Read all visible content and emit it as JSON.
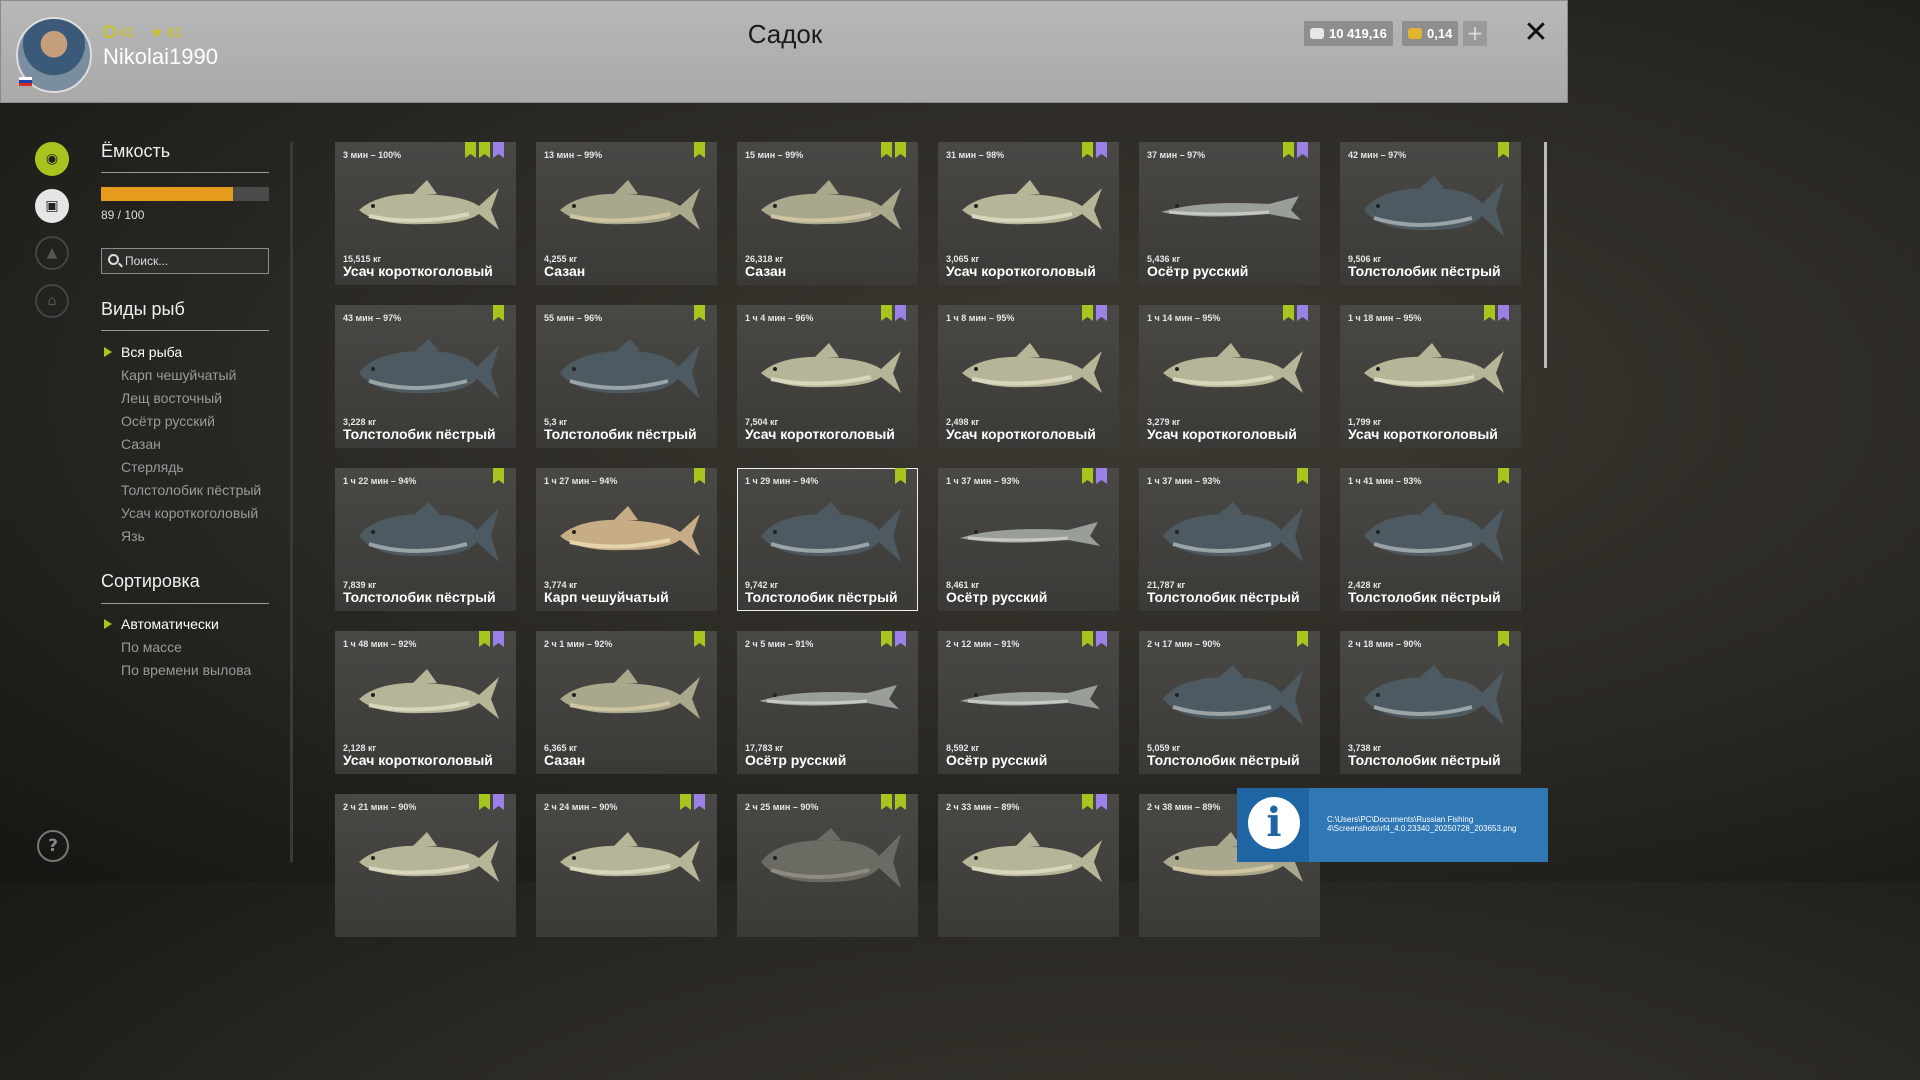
{
  "header": {
    "title": "Садок",
    "level": "41",
    "rank": "81",
    "username": "Nikolai1990",
    "silver": "10 419,16",
    "gold": "0,14",
    "plus_label": "+",
    "close_label": "✕"
  },
  "capacity": {
    "title": "Ёмкость",
    "text": "89 / 100",
    "filled": 89,
    "max": 100,
    "color": "#e79b1c"
  },
  "search": {
    "placeholder": "Поиск..."
  },
  "species": {
    "title": "Виды рыб",
    "items": [
      "Вся рыба",
      "Карп чешуйчатый",
      "Лещ восточный",
      "Осётр русский",
      "Сазан",
      "Стерлядь",
      "Толстолобик пёстрый",
      "Усач короткоголовый",
      "Язь"
    ],
    "selected": 0
  },
  "sort": {
    "title": "Сортировка",
    "items": [
      "Автоматически",
      "По массе",
      "По времени вылова"
    ],
    "selected": 0
  },
  "help_label": "?",
  "cards": [
    {
      "time": "3 мин – 100%",
      "mass": "15,515 кг",
      "name": "Усач короткоголовый",
      "badges": [
        "green",
        "yellow",
        "purple"
      ],
      "fish": "barbel"
    },
    {
      "time": "13 мин – 99%",
      "mass": "4,255 кг",
      "name": "Сазан",
      "badges": [
        "green"
      ],
      "fish": "carp"
    },
    {
      "time": "15 мин – 99%",
      "mass": "26,318 кг",
      "name": "Сазан",
      "badges": [
        "green",
        "yellow"
      ],
      "fish": "carp"
    },
    {
      "time": "31 мин – 98%",
      "mass": "3,065 кг",
      "name": "Усач короткоголовый",
      "badges": [
        "green",
        "purple"
      ],
      "fish": "barbel"
    },
    {
      "time": "37 мин – 97%",
      "mass": "5,436 кг",
      "name": "Осётр русский",
      "badges": [
        "green",
        "purple"
      ],
      "fish": "sturgeon"
    },
    {
      "time": "42 мин – 97%",
      "mass": "9,506 кг",
      "name": "Толстолобик пёстрый",
      "badges": [
        "green"
      ],
      "fish": "bighead"
    },
    {
      "time": "43 мин – 97%",
      "mass": "3,228 кг",
      "name": "Толстолобик пёстрый",
      "badges": [
        "green"
      ],
      "fish": "bighead"
    },
    {
      "time": "55 мин – 96%",
      "mass": "5,3 кг",
      "name": "Толстолобик пёстрый",
      "badges": [
        "green"
      ],
      "fish": "bighead"
    },
    {
      "time": "1 ч 4 мин – 96%",
      "mass": "7,504 кг",
      "name": "Усач короткоголовый",
      "badges": [
        "green",
        "purple"
      ],
      "fish": "barbel"
    },
    {
      "time": "1 ч 8 мин – 95%",
      "mass": "2,498 кг",
      "name": "Усач короткоголовый",
      "badges": [
        "green",
        "purple"
      ],
      "fish": "barbel"
    },
    {
      "time": "1 ч 14 мин – 95%",
      "mass": "3,279 кг",
      "name": "Усач короткоголовый",
      "badges": [
        "green",
        "purple"
      ],
      "fish": "barbel"
    },
    {
      "time": "1 ч 18 мин – 95%",
      "mass": "1,799 кг",
      "name": "Усач короткоголовый",
      "badges": [
        "green",
        "purple"
      ],
      "fish": "barbel"
    },
    {
      "time": "1 ч 22 мин – 94%",
      "mass": "7,839 кг",
      "name": "Толстолобик пёстрый",
      "badges": [
        "green"
      ],
      "fish": "bighead"
    },
    {
      "time": "1 ч 27 мин – 94%",
      "mass": "3,774 кг",
      "name": "Карп чешуйчатый",
      "badges": [
        "green"
      ],
      "fish": "goldcarp"
    },
    {
      "time": "1 ч 29 мин – 94%",
      "mass": "9,742 кг",
      "name": "Толстолобик пёстрый",
      "badges": [
        "green"
      ],
      "fish": "bighead",
      "selected": true
    },
    {
      "time": "1 ч 37 мин – 93%",
      "mass": "8,461 кг",
      "name": "Осётр русский",
      "badges": [
        "green",
        "purple"
      ],
      "fish": "sturgeon"
    },
    {
      "time": "1 ч 37 мин – 93%",
      "mass": "21,787 кг",
      "name": "Толстолобик пёстрый",
      "badges": [
        "green"
      ],
      "fish": "bighead"
    },
    {
      "time": "1 ч 41 мин – 93%",
      "mass": "2,428 кг",
      "name": "Толстолобик пёстрый",
      "badges": [
        "green"
      ],
      "fish": "bighead"
    },
    {
      "time": "1 ч 48 мин – 92%",
      "mass": "2,128 кг",
      "name": "Усач короткоголовый",
      "badges": [
        "green",
        "purple"
      ],
      "fish": "barbel"
    },
    {
      "time": "2 ч 1 мин – 92%",
      "mass": "6,365 кг",
      "name": "Сазан",
      "badges": [
        "green"
      ],
      "fish": "carp"
    },
    {
      "time": "2 ч 5 мин – 91%",
      "mass": "17,783 кг",
      "name": "Осётр русский",
      "badges": [
        "green",
        "purple"
      ],
      "fish": "sturgeon"
    },
    {
      "time": "2 ч 12 мин – 91%",
      "mass": "8,592 кг",
      "name": "Осётр русский",
      "badges": [
        "green",
        "purple"
      ],
      "fish": "sturgeon"
    },
    {
      "time": "2 ч 17 мин – 90%",
      "mass": "5,059 кг",
      "name": "Толстолобик пёстрый",
      "badges": [
        "green"
      ],
      "fish": "bighead"
    },
    {
      "time": "2 ч 18 мин – 90%",
      "mass": "3,738 кг",
      "name": "Толстолобик пёстрый",
      "badges": [
        "green"
      ],
      "fish": "bighead"
    },
    {
      "time": "2 ч 21 мин – 90%",
      "mass": "",
      "name": "",
      "badges": [
        "green",
        "purple"
      ],
      "fish": "barbel"
    },
    {
      "time": "2 ч 24 мин – 90%",
      "mass": "",
      "name": "",
      "badges": [
        "green",
        "purple"
      ],
      "fish": "barbel"
    },
    {
      "time": "2 ч 25 мин – 90%",
      "mass": "",
      "name": "",
      "badges": [
        "green",
        "yellow"
      ],
      "fish": "bream"
    },
    {
      "time": "2 ч 33 мин – 89%",
      "mass": "",
      "name": "",
      "badges": [
        "green",
        "purple"
      ],
      "fish": "barbel"
    },
    {
      "time": "2 ч 38 мин – 89%",
      "mass": "",
      "name": "",
      "badges": [
        "green"
      ],
      "fish": "carp"
    }
  ],
  "notification": {
    "path": "C:\\Users\\PC\\Documents\\Russian Fishing 4\\Screenshots\\rf4_4.0.23340_20250728_203653.png",
    "icon": "info-icon"
  }
}
